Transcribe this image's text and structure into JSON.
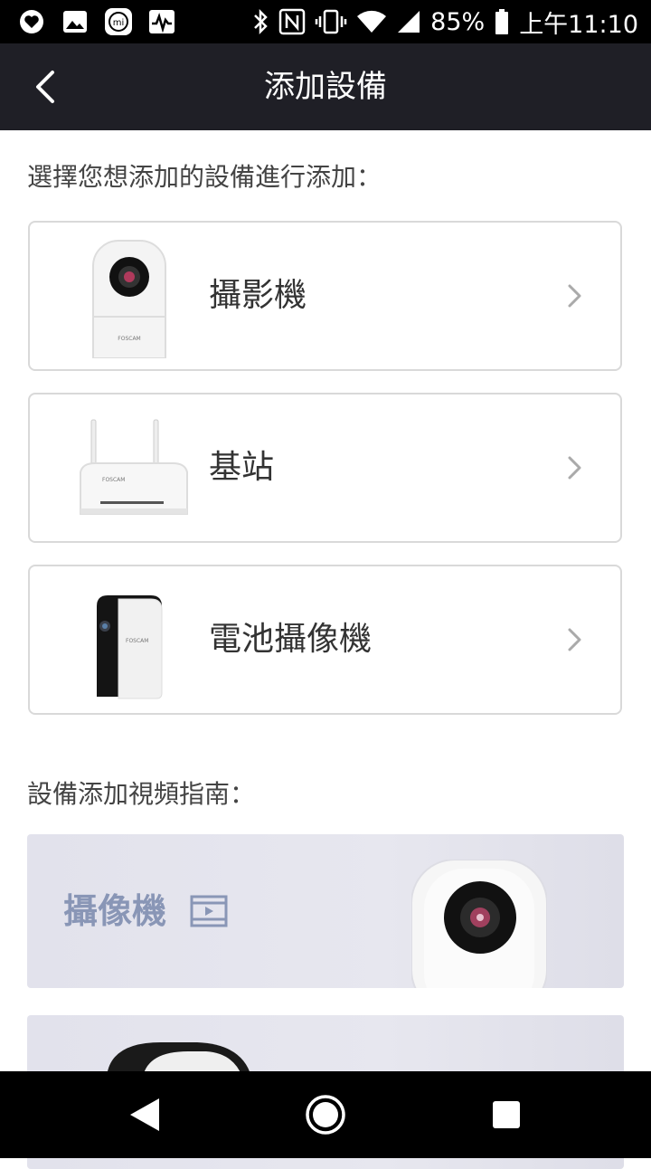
{
  "status_bar": {
    "battery_percent": "85%",
    "time": "上午11:10",
    "left_icons": [
      "heart-app-icon",
      "image-icon",
      "mi-icon",
      "pulse-icon"
    ],
    "right_icons": [
      "bluetooth-icon",
      "nfc-icon",
      "vibrate-icon",
      "wifi-icon",
      "signal-icon",
      "battery-icon"
    ],
    "mi_text": "mi"
  },
  "app_bar": {
    "title": "添加設備",
    "back_icon": "chevron-left-icon"
  },
  "device_section": {
    "prompt": "選擇您想添加的設備進行添加：",
    "items": [
      {
        "label": "攝影機",
        "icon": "ptz-camera-image"
      },
      {
        "label": "基站",
        "icon": "base-station-image"
      },
      {
        "label": "電池攝像機",
        "icon": "battery-camera-image"
      }
    ],
    "brand_text": "FOSCAM"
  },
  "guide_section": {
    "title": "設備添加視頻指南：",
    "items": [
      {
        "label": "攝像機",
        "icon": "video-film-icon"
      },
      {
        "label": "",
        "icon": "battery-camera-image"
      }
    ]
  },
  "nav_bar": {
    "buttons": [
      "back-triangle-icon",
      "home-circle-icon",
      "recents-square-icon"
    ]
  },
  "colors": {
    "app_bar_bg": "#1f1f26",
    "card_border": "#d9d9d9",
    "guide_bg": "#e4e4ee",
    "guide_text": "#8996b6"
  }
}
